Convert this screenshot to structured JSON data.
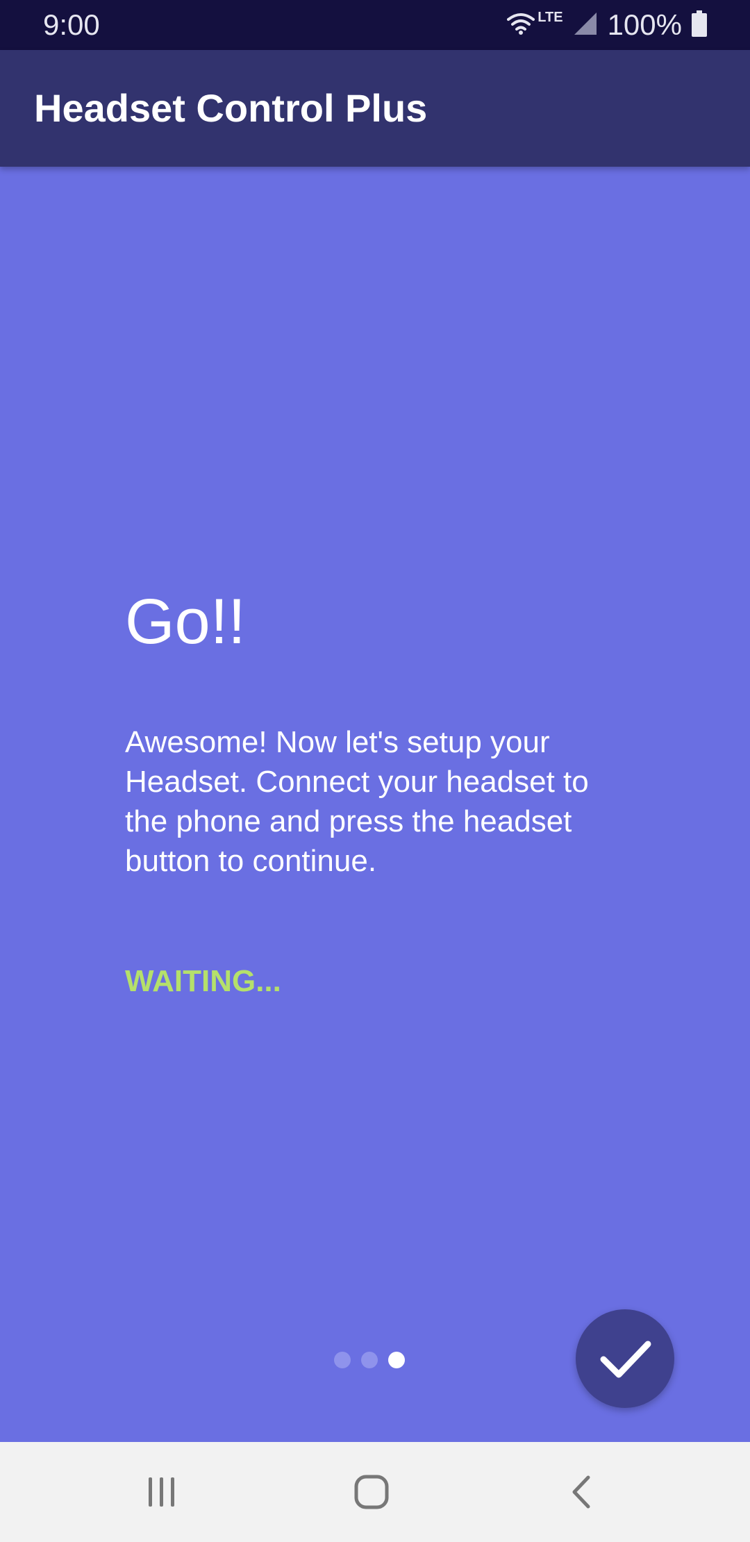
{
  "status_bar": {
    "time": "9:00",
    "network_label": "LTE",
    "battery": "100%",
    "icons": [
      "wifi-icon",
      "signal-icon",
      "battery-icon"
    ]
  },
  "app_bar": {
    "title": "Headset Control Plus"
  },
  "onboarding": {
    "headline": "Go!!",
    "description": "Awesome! Now let's setup your Headset. Connect your headset to the phone and press the headset button to continue.",
    "status": "WAITING...",
    "page_count": 3,
    "current_page": 3,
    "fab_icon": "checkmark-icon"
  },
  "nav_bar": {
    "icons": [
      "recent-apps-icon",
      "home-icon",
      "back-icon"
    ]
  },
  "colors": {
    "status_bar_bg": "#14103f",
    "app_bar_bg": "#32336e",
    "content_bg": "#6a6fe2",
    "accent_waiting": "#b5e06b",
    "fab_bg": "#3f418e"
  }
}
